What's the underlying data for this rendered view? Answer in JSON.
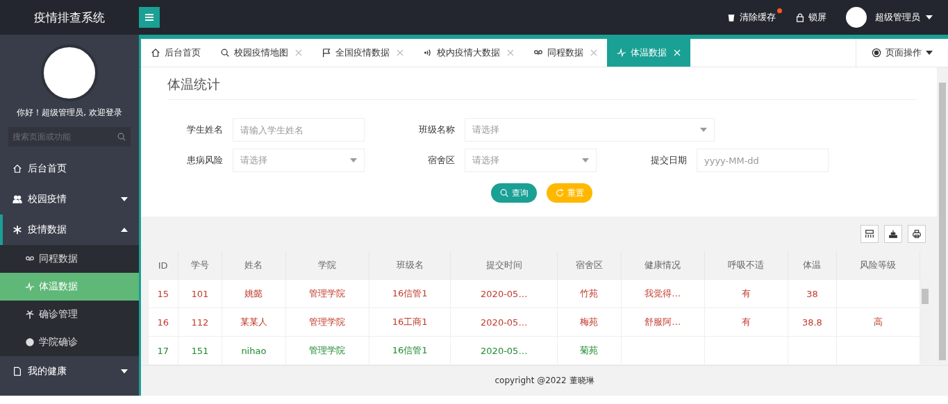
{
  "app_title": "疫情排查系统",
  "header": {
    "actions": [
      {
        "label": "清除缓存",
        "dot": true
      },
      {
        "label": "锁屏",
        "dot": false
      }
    ],
    "user": "超级管理员"
  },
  "sidebar": {
    "greeting": "你好！超级管理员, 欢迎登录",
    "search_placeholder": "搜索页面或功能",
    "items": [
      {
        "label": "后台首页",
        "kind": "link"
      },
      {
        "label": "校园疫情",
        "kind": "group",
        "expanded": false
      },
      {
        "label": "疫情数据",
        "kind": "group",
        "expanded": true,
        "children": [
          {
            "label": "同程数据",
            "selected": false
          },
          {
            "label": "体温数据",
            "selected": true
          },
          {
            "label": "确诊管理",
            "selected": false
          },
          {
            "label": "学院确诊",
            "selected": false
          }
        ]
      },
      {
        "label": "我的健康",
        "kind": "group",
        "expanded": false
      }
    ]
  },
  "tabs": [
    {
      "label": "后台首页",
      "closable": false,
      "selected": false
    },
    {
      "label": "校园疫情地图",
      "closable": true,
      "selected": false
    },
    {
      "label": "全国疫情数据",
      "closable": true,
      "selected": false
    },
    {
      "label": "校内疫情大数据",
      "closable": true,
      "selected": false
    },
    {
      "label": "同程数据",
      "closable": true,
      "selected": false
    },
    {
      "label": "体温数据",
      "closable": true,
      "selected": true
    }
  ],
  "page_actions": "页面操作",
  "section_title": "体温统计",
  "form": {
    "rows": [
      [
        {
          "label": "学生姓名",
          "kind": "text",
          "placeholder": "请输入学生姓名"
        },
        {
          "label": "班级名称",
          "kind": "select",
          "placeholder": "请选择",
          "wide": true
        }
      ],
      [
        {
          "label": "患病风险",
          "kind": "select",
          "placeholder": "请选择",
          "wide": false
        },
        {
          "label": "宿舍区",
          "kind": "select",
          "placeholder": "请选择",
          "wide": false
        },
        {
          "label": "提交日期",
          "kind": "date",
          "placeholder": "yyyy-MM-dd"
        }
      ]
    ],
    "buttons": [
      {
        "label": "查询",
        "kind": "primary"
      },
      {
        "label": "重置",
        "kind": "warn"
      }
    ]
  },
  "table": {
    "columns": [
      "ID",
      "学号",
      "姓名",
      "学院",
      "班级名",
      "提交时间",
      "宿舍区",
      "健康情况",
      "呼吸不适",
      "体温",
      "风险等级"
    ],
    "rows": [
      {
        "color": "#c0392b",
        "cells": [
          "15",
          "101",
          "姚懿",
          "管理学院",
          "16信管1",
          "2020-05…",
          "竹苑",
          "我觉得…",
          "有",
          "38",
          ""
        ]
      },
      {
        "color": "#c0392b",
        "cells": [
          "16",
          "112",
          "某某人",
          "管理学院",
          "16工商1",
          "2020-05…",
          "梅苑",
          "舒服阿…",
          "有",
          "38.8",
          "高"
        ]
      },
      {
        "color": "#1e8a2e",
        "cells": [
          "17",
          "151",
          "nihao",
          "管理学院",
          "16信管1",
          "2020-05…",
          "菊苑",
          "",
          "",
          "",
          ""
        ]
      }
    ]
  },
  "footer": "copyright @2022 董晓琳"
}
